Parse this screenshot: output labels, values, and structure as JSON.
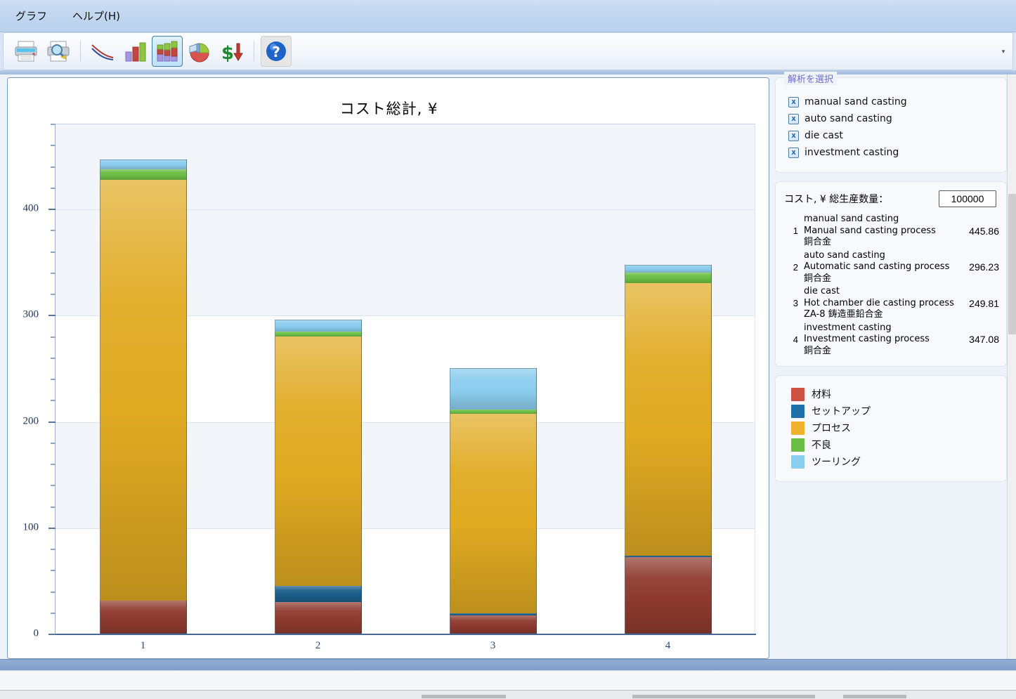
{
  "window": {
    "menu": [
      {
        "label": "グラフ",
        "name": "menu-graph"
      },
      {
        "label": "ヘルプ(H)",
        "name": "menu-help"
      }
    ],
    "toolbar": {
      "buttons": [
        {
          "name": "print-icon",
          "title": "印刷"
        },
        {
          "name": "print-preview-icon",
          "title": "印刷プレビュー"
        },
        {
          "name": "line-chart-icon",
          "title": "折れ線グラフ"
        },
        {
          "name": "bar-chart-icon",
          "title": "棒グラフ"
        },
        {
          "name": "stacked-bar-chart-icon",
          "title": "積み上げ棒グラフ"
        },
        {
          "name": "pie-chart-icon",
          "title": "円グラフ"
        },
        {
          "name": "cost-breakdown-icon",
          "title": "コスト"
        },
        {
          "name": "help-icon",
          "title": "ヘルプ"
        }
      ],
      "overflow_glyph": "▾"
    }
  },
  "analysis_panel": {
    "title": "解析を選択",
    "check_glyph": "x",
    "items": [
      {
        "label": "manual sand casting",
        "checked": true
      },
      {
        "label": "auto sand casting",
        "checked": true
      },
      {
        "label": "die cast",
        "checked": true
      },
      {
        "label": "investment casting",
        "checked": true
      }
    ]
  },
  "cost_panel": {
    "header_label": "コスト, ¥ 総生産数量：",
    "quantity_value": "100000",
    "rows": [
      {
        "index": "1",
        "name": "manual sand casting",
        "process": "Manual sand casting process",
        "material": "銅合金",
        "value": "445.86"
      },
      {
        "index": "2",
        "name": "auto sand casting",
        "process": "Automatic sand casting process",
        "material": "銅合金",
        "value": "296.23"
      },
      {
        "index": "3",
        "name": "die cast",
        "process": "Hot chamber die casting process",
        "material": "ZA-8 鋳造亜鉛合金",
        "value": "249.81"
      },
      {
        "index": "4",
        "name": "investment casting",
        "process": "Investment casting process",
        "material": "銅合金",
        "value": "347.08"
      }
    ]
  },
  "legend_panel": {
    "items": [
      {
        "label": "材料",
        "color": "#cd5241"
      },
      {
        "label": "セットアップ",
        "color": "#1f6fa8"
      },
      {
        "label": "プロセス",
        "color": "#eeb32a"
      },
      {
        "label": "不良",
        "color": "#6cbd45"
      },
      {
        "label": "ツーリング",
        "color": "#8bcdee"
      }
    ]
  },
  "chart_data": {
    "type": "bar",
    "stacked": true,
    "title": "コスト総計, ¥",
    "xlabel": "",
    "ylabel": "",
    "categories": [
      "1",
      "2",
      "3",
      "4"
    ],
    "ylim": [
      0,
      480
    ],
    "yticks": [
      0,
      100,
      200,
      300,
      400
    ],
    "ytick_labels": [
      "0",
      "100",
      "200",
      "300",
      "400"
    ],
    "minor_ticks_per_interval": 5,
    "grid": true,
    "banding": true,
    "legend_position": "external-right",
    "series": [
      {
        "name": "材料",
        "color": "#8e3a2e",
        "values": [
          31.0,
          30.0,
          17.0,
          72.0
        ]
      },
      {
        "name": "セットアップ",
        "color": "#1a5e8a",
        "values": [
          0.0,
          15.0,
          2.0,
          1.5
        ]
      },
      {
        "name": "プロセス",
        "color": "#e0aa22",
        "values": [
          396.0,
          234.5,
          188.0,
          256.5
        ]
      },
      {
        "name": "不良",
        "color": "#6cbd45",
        "values": [
          10.0,
          5.0,
          4.0,
          10.0
        ]
      },
      {
        "name": "ツーリング",
        "color": "#8bcdee",
        "values": [
          9.5,
          11.0,
          39.0,
          7.0
        ]
      }
    ],
    "totals": [
      445.86,
      296.23,
      249.81,
      347.08
    ]
  }
}
